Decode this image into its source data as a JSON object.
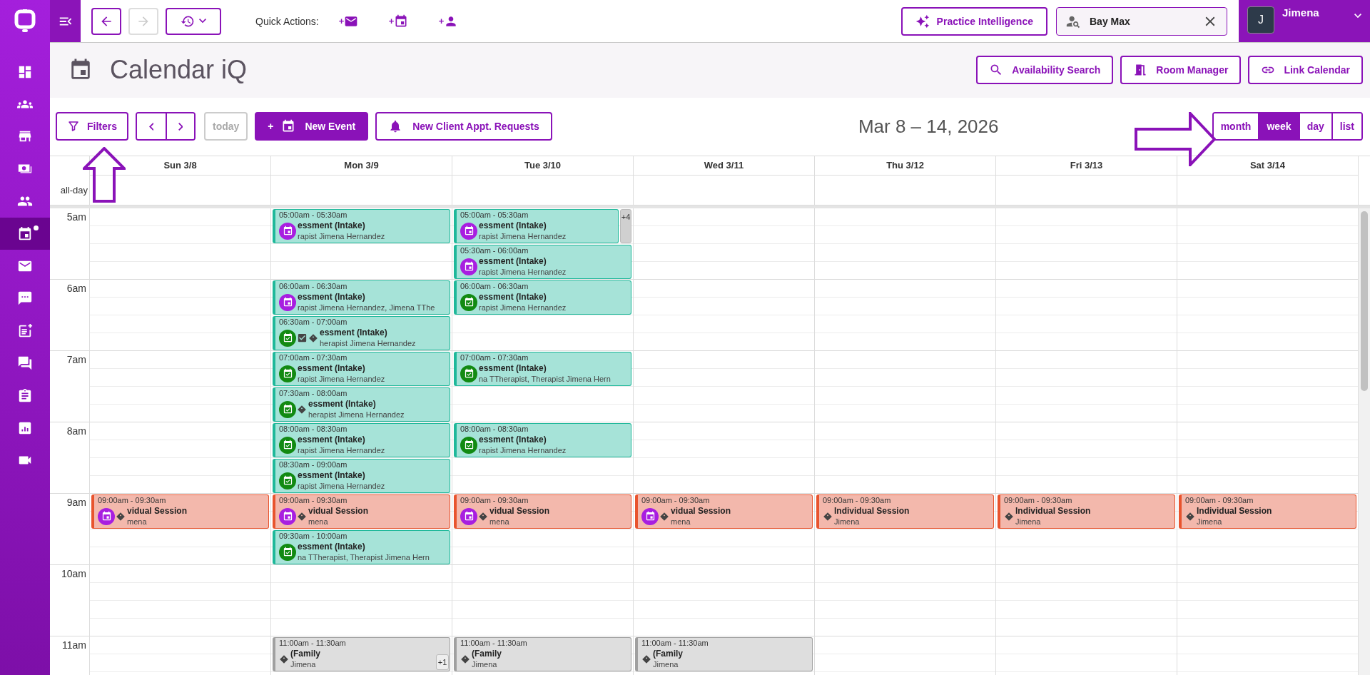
{
  "sidebar": {
    "items": [
      {
        "kind": "dashboard",
        "selected": false,
        "notification": false
      },
      {
        "kind": "group",
        "selected": false,
        "notification": false
      },
      {
        "kind": "store",
        "selected": false,
        "notification": false
      },
      {
        "kind": "cash",
        "selected": false,
        "notification": false
      },
      {
        "kind": "people",
        "selected": false,
        "notification": false
      },
      {
        "kind": "calendar",
        "selected": true,
        "notification": true
      },
      {
        "kind": "mail",
        "selected": false,
        "notification": false
      },
      {
        "kind": "chat",
        "selected": false,
        "notification": false
      },
      {
        "kind": "note",
        "selected": false,
        "notification": false
      },
      {
        "kind": "forum",
        "selected": false,
        "notification": false
      },
      {
        "kind": "clipboard",
        "selected": false,
        "notification": false
      },
      {
        "kind": "chart",
        "selected": false,
        "notification": false
      },
      {
        "kind": "video",
        "selected": false,
        "notification": false
      }
    ]
  },
  "top_bar": {
    "back": {
      "disabled": false
    },
    "forward": {
      "disabled": true
    },
    "quick_actions": {
      "label": "Quick Actions:",
      "items": [
        {
          "kind": "message",
          "prefix": "+"
        },
        {
          "kind": "event",
          "prefix": "+"
        },
        {
          "kind": "client",
          "prefix": "+"
        }
      ]
    },
    "practice_button": "Practice Intelligence",
    "client_search": {
      "value": "Bay Max"
    },
    "user": {
      "initial": "J",
      "name": "Jimena"
    }
  },
  "page_header": {
    "title": "Calendar iQ",
    "actions": [
      {
        "kind": "search",
        "label": "Availability Search"
      },
      {
        "kind": "room",
        "label": "Room Manager"
      },
      {
        "kind": "link",
        "label": "Link Calendar"
      }
    ]
  },
  "toolbar": {
    "filters": "Filters",
    "today": {
      "label": "today",
      "disabled": true
    },
    "new_event": {
      "prefix": "+",
      "label": "New Event"
    },
    "requests": "New Client Appt. Requests",
    "range": "Mar 8 – 14, 2026",
    "views": [
      {
        "label": "month",
        "selected": false
      },
      {
        "label": "week",
        "selected": true
      },
      {
        "label": "day",
        "selected": false
      },
      {
        "label": "list",
        "selected": false
      }
    ]
  },
  "annotations": [
    {
      "kind": "arrow"
    },
    {
      "kind": "arrow"
    }
  ],
  "calendar": {
    "all_day_label": "all-day",
    "hours": [
      "5am",
      "6am",
      "7am",
      "8am",
      "9am",
      "10am",
      "11am"
    ],
    "days": [
      {
        "label": "Sun 3/8",
        "events": [
          {
            "kind": "session",
            "time": "09:00am - 09:30am",
            "title": "vidual Session",
            "person": "mena",
            "badges": [
              {
                "kind": "scheduled"
              },
              {
                "kind": "tag"
              }
            ]
          }
        ]
      },
      {
        "label": "Mon 3/9",
        "events": [
          {
            "kind": "intake",
            "time": "05:00am - 05:30am",
            "title": "essment (Intake)",
            "person": "rapist Jimena Hernandez",
            "badges": [
              {
                "kind": "scheduled"
              }
            ]
          },
          {
            "kind": "intake",
            "time": "06:00am - 06:30am",
            "title": "essment (Intake)",
            "person": "rapist Jimena Hernandez, Jimena TThe",
            "badges": [
              {
                "kind": "scheduled"
              }
            ]
          },
          {
            "kind": "intake",
            "time": "06:30am - 07:00am",
            "title": "essment (Intake)",
            "person": "herapist Jimena Hernandez",
            "badges": [
              {
                "kind": "confirmed"
              },
              {
                "kind": "checked"
              },
              {
                "kind": "tag"
              }
            ]
          },
          {
            "kind": "intake",
            "time": "07:00am - 07:30am",
            "title": "essment (Intake)",
            "person": "rapist Jimena Hernandez",
            "badges": [
              {
                "kind": "confirmed"
              }
            ]
          },
          {
            "kind": "intake",
            "time": "07:30am - 08:00am",
            "title": "essment (Intake)",
            "person": "herapist Jimena Hernandez",
            "badges": [
              {
                "kind": "confirmed"
              },
              {
                "kind": "tag"
              }
            ]
          },
          {
            "kind": "intake",
            "time": "08:00am - 08:30am",
            "title": "essment (Intake)",
            "person": "rapist Jimena Hernandez",
            "badges": [
              {
                "kind": "confirmed"
              }
            ]
          },
          {
            "kind": "intake",
            "time": "08:30am - 09:00am",
            "title": "essment (Intake)",
            "person": "rapist Jimena Hernandez",
            "badges": [
              {
                "kind": "confirmed"
              }
            ]
          },
          {
            "kind": "session",
            "time": "09:00am - 09:30am",
            "title": "vidual Session",
            "person": "mena",
            "badges": [
              {
                "kind": "scheduled"
              },
              {
                "kind": "tag"
              }
            ]
          },
          {
            "kind": "intake",
            "time": "09:30am - 10:00am",
            "title": "essment (Intake)",
            "person": "na TTherapist, Therapist Jimena Hern",
            "badges": [
              {
                "kind": "confirmed"
              }
            ]
          },
          {
            "kind": "family",
            "time": "11:00am - 11:30am",
            "title": "(Family",
            "person": "Jimena",
            "badges": [
              {
                "kind": "tag"
              }
            ],
            "more": "+1"
          }
        ]
      },
      {
        "label": "Tue 3/10",
        "events": [
          {
            "kind": "intake",
            "time": "05:00am - 05:30am",
            "title": "essment (Intake)",
            "person": "rapist Jimena Hernandez",
            "badges": [
              {
                "kind": "scheduled"
              }
            ],
            "more": "+4"
          },
          {
            "kind": "intake",
            "time": "05:30am - 06:00am",
            "title": "essment (Intake)",
            "person": "rapist Jimena Hernandez",
            "badges": [
              {
                "kind": "scheduled"
              }
            ]
          },
          {
            "kind": "intake",
            "time": "06:00am - 06:30am",
            "title": "essment (Intake)",
            "person": "rapist Jimena Hernandez",
            "badges": [
              {
                "kind": "confirmed"
              }
            ]
          },
          {
            "kind": "intake",
            "time": "07:00am - 07:30am",
            "title": "essment (Intake)",
            "person": "na TTherapist, Therapist Jimena Hern",
            "badges": [
              {
                "kind": "confirmed"
              }
            ]
          },
          {
            "kind": "intake",
            "time": "08:00am - 08:30am",
            "title": "essment (Intake)",
            "person": "rapist Jimena Hernandez",
            "badges": [
              {
                "kind": "confirmed"
              }
            ]
          },
          {
            "kind": "session",
            "time": "09:00am - 09:30am",
            "title": "vidual Session",
            "person": "mena",
            "badges": [
              {
                "kind": "scheduled"
              },
              {
                "kind": "tag"
              }
            ]
          },
          {
            "kind": "family",
            "time": "11:00am - 11:30am",
            "title": "(Family",
            "person": "Jimena",
            "badges": [
              {
                "kind": "tag"
              }
            ]
          }
        ]
      },
      {
        "label": "Wed 3/11",
        "events": [
          {
            "kind": "session",
            "time": "09:00am - 09:30am",
            "title": "vidual Session",
            "person": "mena",
            "badges": [
              {
                "kind": "scheduled"
              },
              {
                "kind": "tag"
              }
            ]
          },
          {
            "kind": "family",
            "time": "11:00am - 11:30am",
            "title": "(Family",
            "person": "Jimena",
            "badges": [
              {
                "kind": "tag"
              }
            ]
          }
        ]
      },
      {
        "label": "Thu 3/12",
        "events": [
          {
            "kind": "session",
            "time": "09:00am - 09:30am",
            "title": "Individual Session",
            "person": "Jimena",
            "badges": [
              {
                "kind": "tag"
              }
            ]
          }
        ]
      },
      {
        "label": "Fri 3/13",
        "events": [
          {
            "kind": "session",
            "time": "09:00am - 09:30am",
            "title": "Individual Session",
            "person": "Jimena",
            "badges": [
              {
                "kind": "tag"
              }
            ]
          }
        ]
      },
      {
        "label": "Sat 3/14",
        "events": [
          {
            "kind": "session",
            "time": "09:00am - 09:30am",
            "title": "Individual Session",
            "person": "Jimena",
            "badges": [
              {
                "kind": "tag"
              }
            ]
          }
        ]
      }
    ]
  }
}
